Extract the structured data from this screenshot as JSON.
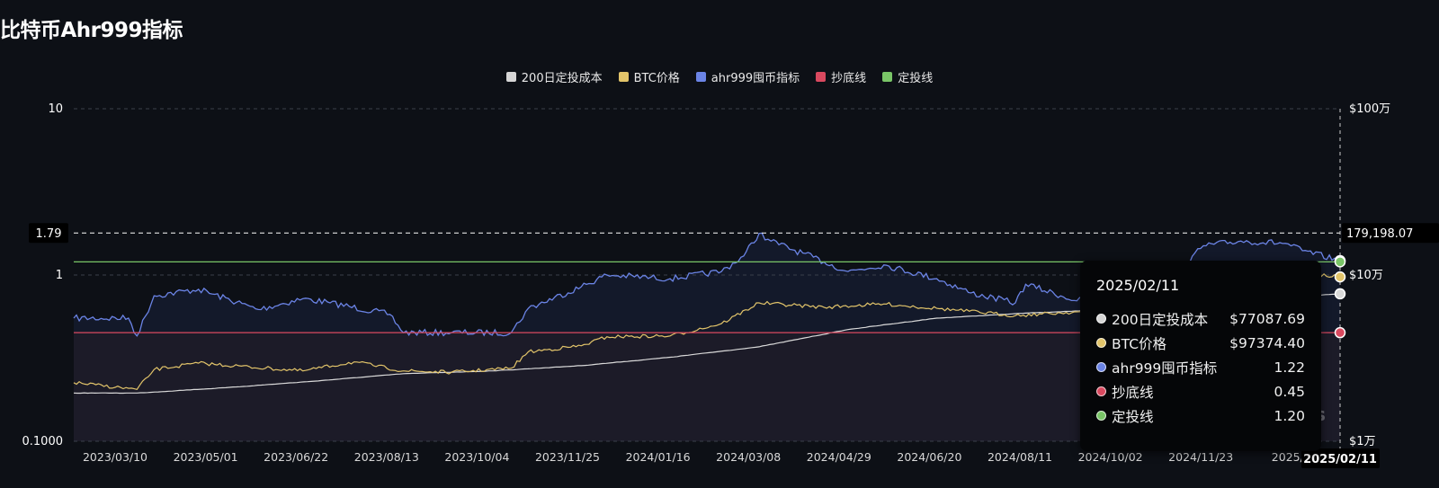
{
  "page": {
    "title": "比特币Ahr999指标"
  },
  "colors": {
    "background": "#0d1016",
    "cost": "#d9d9d9",
    "price": "#e2c46a",
    "ahr": "#6b84e6",
    "bottom": "#d9495f",
    "dca": "#79c567",
    "lower_zone": "#201c28"
  },
  "legend": [
    {
      "label": "200日定投成本",
      "color": "#d6d6d6"
    },
    {
      "label": "BTC价格",
      "color": "#e2c46a"
    },
    {
      "label": "ahr999囤币指标",
      "color": "#6b84e6"
    },
    {
      "label": "抄底线",
      "color": "#d9495f"
    },
    {
      "label": "定投线",
      "color": "#79c567"
    }
  ],
  "chart_data": {
    "type": "line",
    "title": "比特币Ahr999指标",
    "x_type": "date",
    "x_range": [
      "2023-02-01",
      "2025-02-11"
    ],
    "x_tick_labels": [
      "2023/03/10",
      "2023/05/01",
      "2023/06/22",
      "2023/08/13",
      "2023/10/04",
      "2023/11/25",
      "2024/01/16",
      "2024/03/08",
      "2024/04/29",
      "2024/06/20",
      "2024/08/11",
      "2024/10/02",
      "2024/11/23",
      "2025/0"
    ],
    "left_axis": {
      "scale": "log",
      "ticks": [
        "10",
        "1",
        "0.1000"
      ],
      "range": [
        0.1,
        10
      ]
    },
    "right_axis": {
      "scale": "log",
      "ticks": [
        "$100万",
        "$10万",
        "$1万"
      ],
      "range": [
        10000,
        1000000
      ]
    },
    "crosshair": {
      "x": "2025/02/11",
      "left_value": "1.79",
      "right_value": "179,198.07"
    },
    "series": [
      {
        "name": "ahr999囤币指标",
        "axis": "left",
        "x": [
          "2023-02-01",
          "2023-03-05",
          "2023-03-10",
          "2023-03-20",
          "2023-04-15",
          "2023-05-20",
          "2023-06-15",
          "2023-07-01",
          "2023-08-05",
          "2023-08-13",
          "2023-09-10",
          "2023-10-15",
          "2023-10-25",
          "2023-11-25",
          "2023-12-10",
          "2024-01-16",
          "2024-02-15",
          "2024-02-28",
          "2024-03-08",
          "2024-03-15",
          "2024-04-15",
          "2024-04-29",
          "2024-05-20",
          "2024-06-20",
          "2024-07-10",
          "2024-08-05",
          "2024-08-11",
          "2024-09-10",
          "2024-10-02",
          "2024-11-05",
          "2024-11-23",
          "2024-12-15",
          "2025-01-10",
          "2025-01-20",
          "2025-02-11"
        ],
        "y": [
          0.55,
          0.55,
          0.43,
          0.75,
          0.82,
          0.62,
          0.72,
          0.68,
          0.58,
          0.45,
          0.45,
          0.45,
          0.63,
          0.85,
          1.0,
          0.95,
          1.05,
          1.3,
          1.78,
          1.6,
          1.2,
          1.05,
          1.15,
          0.95,
          0.78,
          0.68,
          0.88,
          0.7,
          0.78,
          0.95,
          1.5,
          1.6,
          1.55,
          1.4,
          1.22
        ]
      },
      {
        "name": "BTC价格",
        "axis": "right",
        "x": [
          "2023-02-01",
          "2023-03-10",
          "2023-03-20",
          "2023-04-15",
          "2023-06-15",
          "2023-07-15",
          "2023-08-13",
          "2023-09-10",
          "2023-10-15",
          "2023-10-25",
          "2023-11-25",
          "2023-12-10",
          "2024-01-16",
          "2024-02-15",
          "2024-03-08",
          "2024-04-15",
          "2024-05-20",
          "2024-06-20",
          "2024-08-05",
          "2024-09-10",
          "2024-10-02",
          "2024-11-23",
          "2024-12-15",
          "2025-01-20",
          "2025-02-11"
        ],
        "y": [
          22500,
          20500,
          27000,
          29500,
          26500,
          30000,
          26500,
          26000,
          27500,
          34500,
          37500,
          42500,
          43000,
          51000,
          68000,
          64000,
          67000,
          63000,
          57000,
          60000,
          61000,
          95000,
          100000,
          102000,
          97374.4
        ]
      },
      {
        "name": "200日定投成本",
        "axis": "right",
        "x": [
          "2023-02-01",
          "2023-03-10",
          "2023-05-01",
          "2023-06-22",
          "2023-08-13",
          "2023-10-04",
          "2023-11-25",
          "2024-01-16",
          "2024-03-08",
          "2024-04-29",
          "2024-06-20",
          "2024-08-11",
          "2024-10-02",
          "2024-11-23",
          "2025-02-11"
        ],
        "y": [
          19500,
          19500,
          21000,
          23000,
          25500,
          26500,
          28500,
          32000,
          37000,
          47000,
          55000,
          59000,
          62000,
          68000,
          77087.69
        ]
      },
      {
        "name": "抄底线",
        "axis": "left",
        "x": [
          "2023-02-01",
          "2025-02-11"
        ],
        "y": [
          0.45,
          0.45
        ]
      },
      {
        "name": "定投线",
        "axis": "left",
        "x": [
          "2023-02-01",
          "2025-02-11"
        ],
        "y": [
          1.2,
          1.2
        ]
      }
    ]
  },
  "tooltip": {
    "date": "2025/02/11",
    "rows": [
      {
        "name": "200日定投成本",
        "value": "$77087.69",
        "color": "#d6d6d6"
      },
      {
        "name": "BTC价格",
        "value": "$97374.40",
        "color": "#e2c46a"
      },
      {
        "name": "ahr999囤币指标",
        "value": "1.22",
        "color": "#6b84e6"
      },
      {
        "name": "抄底线",
        "value": "0.45",
        "color": "#d9495f"
      },
      {
        "name": "定投线",
        "value": "1.20",
        "color": "#79c567"
      }
    ]
  },
  "watermark": "s"
}
